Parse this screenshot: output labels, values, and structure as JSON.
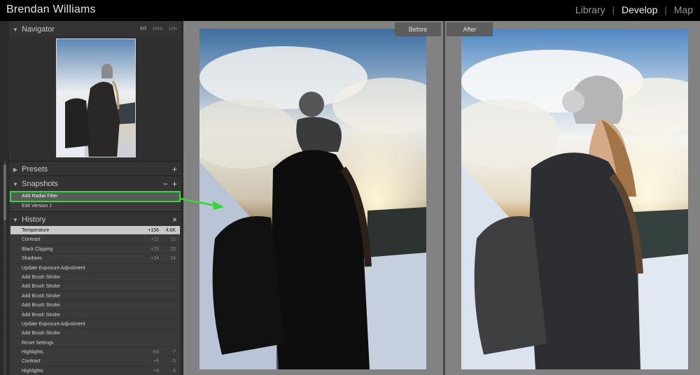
{
  "app": {
    "title": "Brendan Williams"
  },
  "modules": [
    "Library",
    "Develop",
    "Map"
  ],
  "active_module": "Develop",
  "navigator": {
    "title": "Navigator",
    "zoom": [
      "FIT",
      "100%",
      "12%"
    ]
  },
  "presets": {
    "title": "Presets",
    "add": "+"
  },
  "snapshots": {
    "title": "Snapshots",
    "remove": "−",
    "add": "+",
    "items": [
      "Add Radial Filter",
      "Edit Version 1"
    ],
    "selected_index": 0
  },
  "history": {
    "title": "History",
    "clear": "×",
    "items": [
      {
        "label": "Temperature",
        "delta": "+156",
        "value": "4.6K"
      },
      {
        "label": "Contrast",
        "delta": "+11",
        "value": "11"
      },
      {
        "label": "Black Clipping",
        "delta": "+25",
        "value": "25"
      },
      {
        "label": "Shadows",
        "delta": "+34",
        "value": "34"
      },
      {
        "label": "Update Exposure Adjustment",
        "delta": "",
        "value": ""
      },
      {
        "label": "Add Brush Stroke",
        "delta": "",
        "value": ""
      },
      {
        "label": "Add Brush Stroke",
        "delta": "",
        "value": ""
      },
      {
        "label": "Add Brush Stroke",
        "delta": "",
        "value": ""
      },
      {
        "label": "Add Brush Stroke",
        "delta": "",
        "value": ""
      },
      {
        "label": "Add Brush Stroke",
        "delta": "",
        "value": ""
      },
      {
        "label": "Update Exposure Adjustment",
        "delta": "",
        "value": ""
      },
      {
        "label": "Add Brush Stroke",
        "delta": "",
        "value": ""
      },
      {
        "label": "Reset Settings",
        "delta": "",
        "value": ""
      },
      {
        "label": "Highlights",
        "delta": "-53",
        "value": "-7"
      },
      {
        "label": "Contrast",
        "delta": "+6",
        "value": "6"
      },
      {
        "label": "Highlights",
        "delta": "+6",
        "value": "6"
      }
    ],
    "selected_index": 0
  },
  "compare": {
    "before_label": "Before",
    "after_label": "After"
  },
  "colors": {
    "highlight_green": "#39d43a",
    "panel": "#333333",
    "canvas": "#828282"
  }
}
